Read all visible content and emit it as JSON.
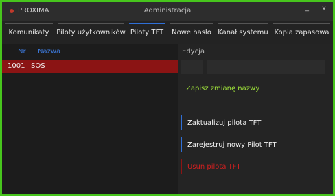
{
  "window": {
    "app_name": "PROXIMA",
    "title": "Administracja",
    "minimize_glyph": "_",
    "close_glyph": "x",
    "accent_color": "#47c51d"
  },
  "tabs": [
    {
      "label": "Komunikaty",
      "active": false
    },
    {
      "label": "Piloty użytkowników",
      "active": false
    },
    {
      "label": "Piloty TFT",
      "active": true
    },
    {
      "label": "Nowe hasło",
      "active": false
    },
    {
      "label": "Kanał systemu",
      "active": false
    },
    {
      "label": "Kopia zapasowa",
      "active": false
    }
  ],
  "list": {
    "headers": {
      "nr": "Nr",
      "name": "Nazwa"
    },
    "rows": [
      {
        "nr": "1001",
        "name": "SOS",
        "selected": true
      }
    ],
    "selected_color": "#8b1414"
  },
  "edit": {
    "label": "Edycja",
    "name_value": "",
    "save_label": "Zapisz zmianę nazwy",
    "update_label": "Zaktualizuj pilota TFT",
    "register_label": "Zarejestruj nowy Pilot TFT",
    "delete_label": "Usuń pilota TFT"
  }
}
